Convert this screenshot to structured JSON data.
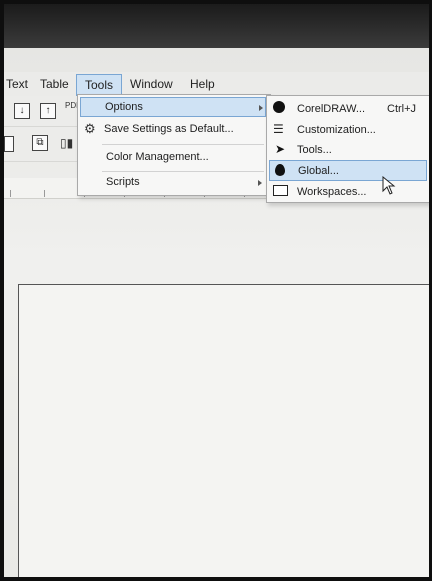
{
  "menubar": {
    "items": [
      {
        "label": "Text"
      },
      {
        "label": "Table"
      },
      {
        "label": "Tools"
      },
      {
        "label": "Window"
      },
      {
        "label": "Help"
      }
    ]
  },
  "tools_menu": {
    "items": [
      {
        "label": "Options"
      },
      {
        "label": "Save Settings as Default..."
      },
      {
        "label": "Color Management..."
      },
      {
        "label": "Scripts"
      }
    ]
  },
  "options_submenu": {
    "items": [
      {
        "label": "CorelDRAW...",
        "shortcut": "Ctrl+J",
        "icon": "coreldraw-icon"
      },
      {
        "label": "Customization...",
        "icon": "customization-icon"
      },
      {
        "label": "Tools...",
        "icon": "pointer-icon"
      },
      {
        "label": "Global...",
        "icon": "balloon-icon"
      },
      {
        "label": "Workspaces...",
        "icon": "monitor-icon"
      }
    ]
  },
  "toolbar": {
    "pdf_label": "PDF"
  },
  "colors": {
    "highlight": "#cfe2f4",
    "highlight_border": "#7aa6d3"
  }
}
